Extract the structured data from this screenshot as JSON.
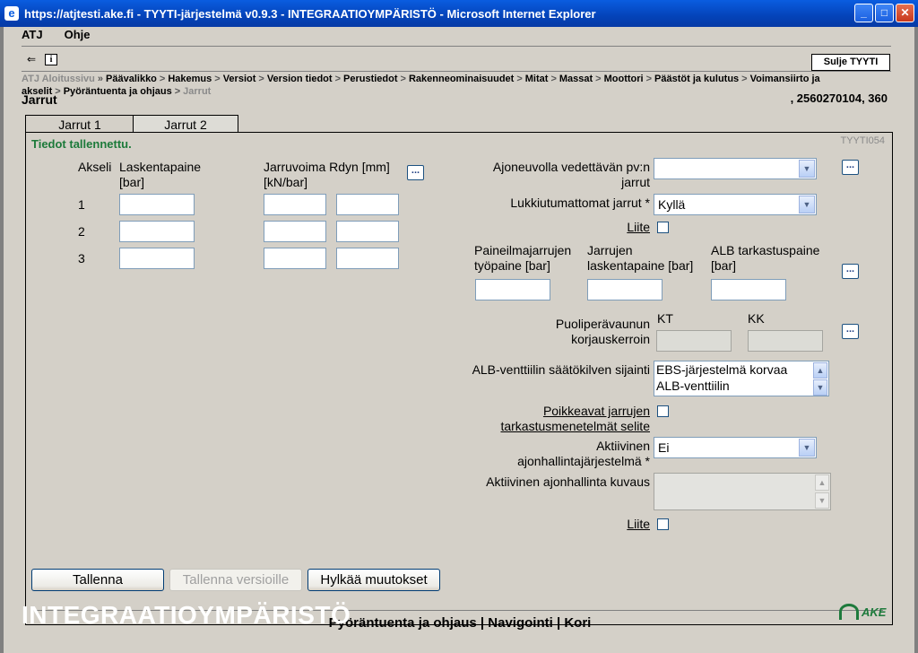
{
  "window": {
    "title": "https://atjtesti.ake.fi - TYYTI-järjestelmä v0.9.3 - INTEGRAATIOYMPÄRISTÖ - Microsoft Internet Explorer",
    "minimize": "_",
    "maximize": "□",
    "close": "✕"
  },
  "menu": {
    "items": [
      "ATJ",
      "Ohje"
    ]
  },
  "toolbar": {
    "back_icon": "⇐",
    "info_icon": "i",
    "close_button": "Sulje TYYTI"
  },
  "breadcrumb": {
    "root": "ATJ Aloitussivu",
    "root_sep": "»",
    "items": [
      "Päävalikko",
      "Hakemus",
      "Versiot",
      "Version tiedot",
      "Perustiedot",
      "Rakenneominaisuudet",
      "Mitat",
      "Massat",
      "Moottori",
      "Päästöt ja kulutus",
      "Voimansiirto ja akselit",
      "Pyöräntuenta ja ohjaus"
    ],
    "current": "Jarrut",
    "sep": ">"
  },
  "page": {
    "heading": "Jarrut",
    "vehicle_id": ", 2560270104, 360"
  },
  "tabs": [
    {
      "label": "Jarrut 1",
      "active": false
    },
    {
      "label": "Jarrut 2",
      "active": true
    }
  ],
  "form": {
    "status_message": "Tiedot tallennettu.",
    "form_code": "TYYTI054",
    "axle_header": "Akseli",
    "calc_pressure_header": "Laskentapaine [bar]",
    "brake_force_header": "Jarruvoima Rdyn [mm] [kN/bar]",
    "axles": [
      "1",
      "2",
      "3"
    ],
    "towed_vehicle_label": "Ajoneuvolla vedettävän pv:n jarrut",
    "towed_vehicle_value": "",
    "antilock_label": "Lukkiutumattomat jarrut *",
    "antilock_value": "Kyllä",
    "attachment_label": "Liite",
    "air_brake_pressure_label": "Paineilmajarrujen työpaine [bar]",
    "brake_calc_pressure_label": "Jarrujen laskentapaine [bar]",
    "alb_check_pressure_label": "ALB tarkastuspaine [bar]",
    "semitrailer_label": "Puoliperävaunun korjauskerroin",
    "kt_label": "KT",
    "kk_label": "KK",
    "alb_lever_label": "ALB-venttiilin säätökilven sijainti",
    "alb_lever_options": [
      "EBS-järjestelmä korvaa",
      "ALB-venttiilin"
    ],
    "deviating_methods_label": "Poikkeavat jarrujen tarkastusmenetelmät selite",
    "active_control_label": "Aktiivinen ajonhallintajärjestelmä *",
    "active_control_value": "Ei",
    "active_control_desc_label": "Aktiivinen ajonhallinta kuvaus",
    "attachment_label_2": "Liite",
    "ellipsis": "..."
  },
  "buttons": {
    "save": "Tallenna",
    "save_versions": "Tallenna versioille",
    "discard": "Hylkää muutokset"
  },
  "footer_nav": {
    "items": [
      "Pyöräntuenta ja ohjaus",
      "Navigointi",
      "Kori"
    ],
    "sep": "|"
  },
  "environment_banner": "INTEGRAATIOYMPÄRISTÖ",
  "logo_text": "AKE"
}
